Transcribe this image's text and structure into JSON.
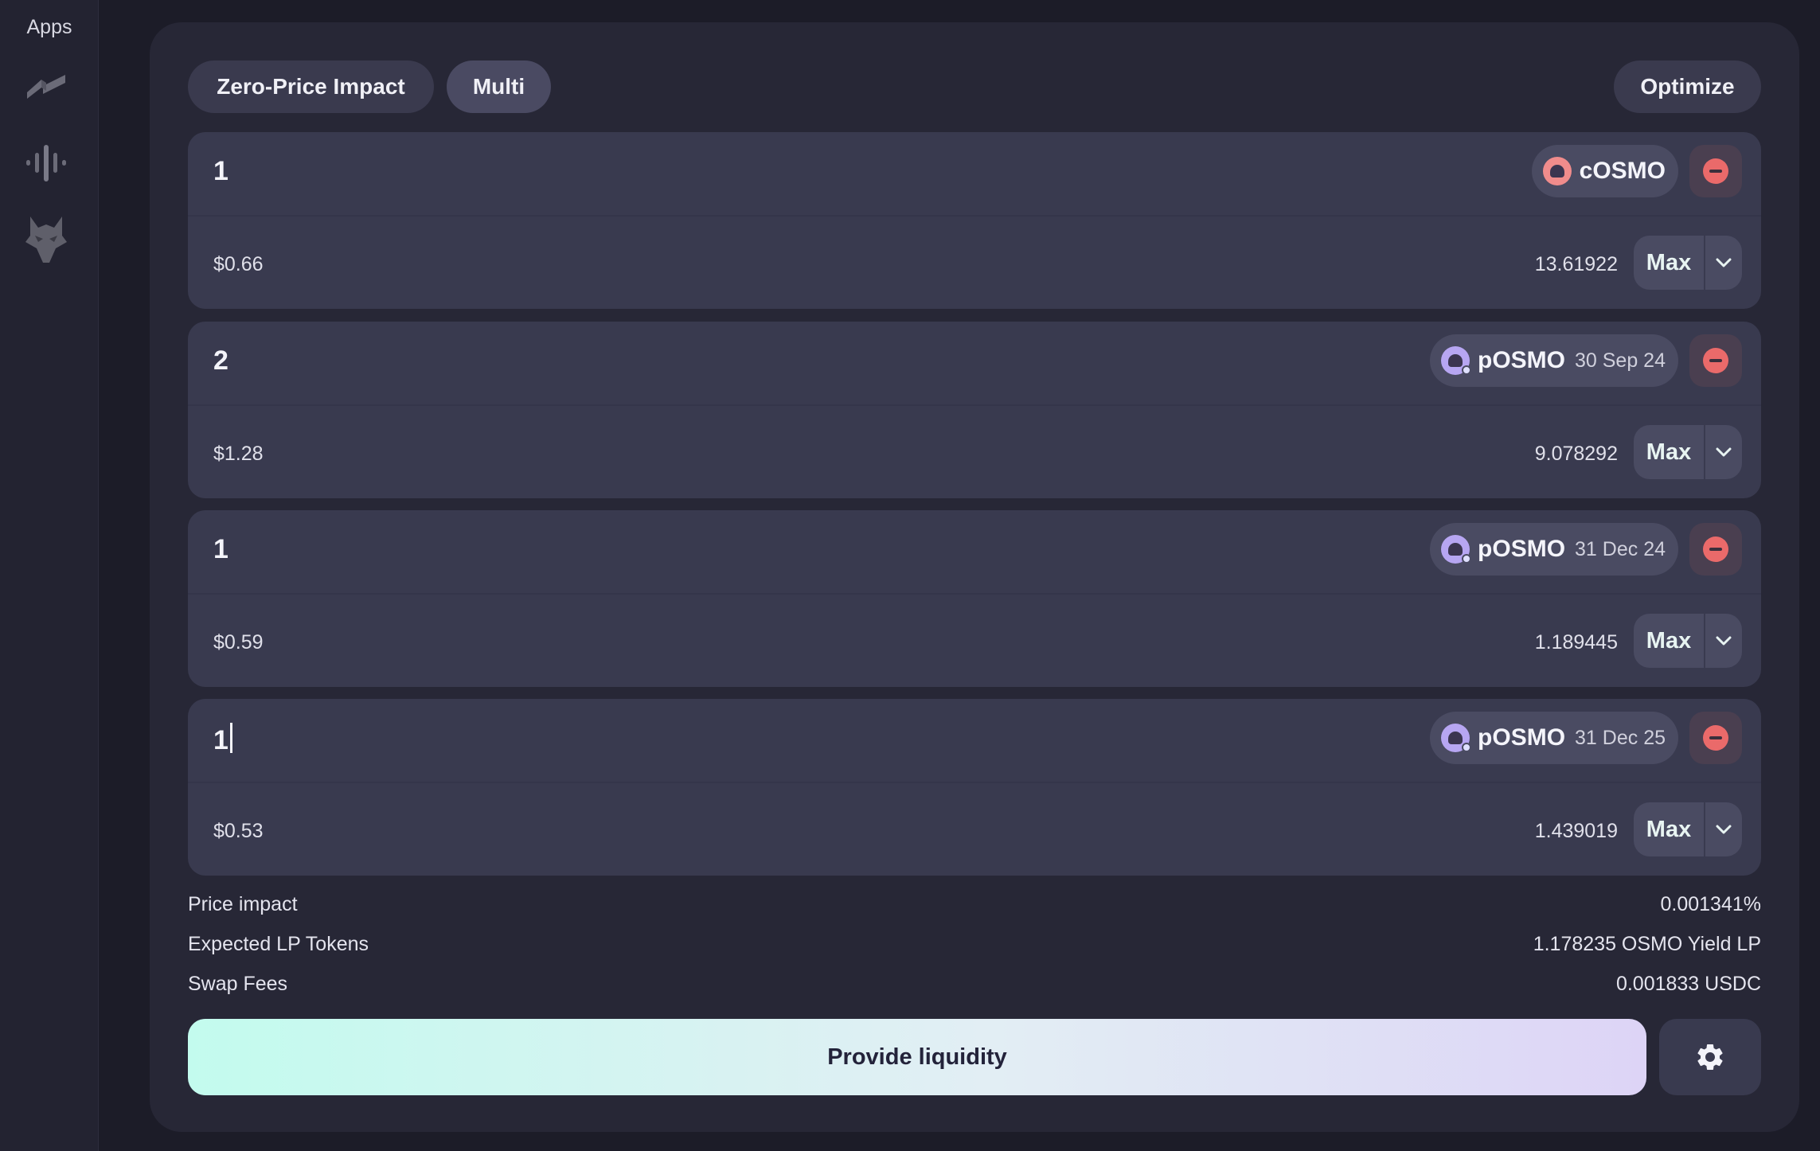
{
  "sidebar": {
    "title": "Apps",
    "apps": [
      {
        "icon": "strata-logo-icon"
      },
      {
        "icon": "equalizer-logo-icon"
      },
      {
        "icon": "wolf-logo-icon"
      }
    ]
  },
  "tabs": {
    "zero_price_impact": "Zero-Price Impact",
    "multi": "Multi",
    "optimize": "Optimize",
    "active": "Multi"
  },
  "tokens": [
    {
      "amount": "1",
      "usd": "$0.66",
      "symbol": "cOSMO",
      "date": "",
      "balance": "13.61922",
      "max_label": "Max",
      "icon": "cosmo-token-icon",
      "icon_color": "#f08c8c"
    },
    {
      "amount": "2",
      "usd": "$1.28",
      "symbol": "pOSMO",
      "date": "30 Sep 24",
      "balance": "9.078292",
      "max_label": "Max",
      "icon": "posmo-token-icon",
      "icon_color": "#b7a6f2"
    },
    {
      "amount": "1",
      "usd": "$0.59",
      "symbol": "pOSMO",
      "date": "31 Dec 24",
      "balance": "1.189445",
      "max_label": "Max",
      "icon": "posmo-token-icon",
      "icon_color": "#b7a6f2"
    },
    {
      "amount": "1",
      "usd": "$0.53",
      "symbol": "pOSMO",
      "date": "31 Dec 25",
      "balance": "1.439019",
      "max_label": "Max",
      "icon": "posmo-token-icon",
      "icon_color": "#b7a6f2"
    }
  ],
  "summary": {
    "price_impact_label": "Price impact",
    "price_impact_value": "0.001341%",
    "expected_lp_label": "Expected LP Tokens",
    "expected_lp_value": "1.178235 OSMO Yield LP",
    "swap_fees_label": "Swap Fees",
    "swap_fees_value": "0.001833 USDC"
  },
  "actions": {
    "provide_label": "Provide liquidity",
    "settings_icon": "gear-icon"
  },
  "colors": {
    "background": "#1c1c28",
    "panel": "#272736",
    "card": "#393a4f",
    "remove_red": "#ea6a6a",
    "gradient_start": "#c3fbee",
    "gradient_end": "#ddd4f6"
  }
}
